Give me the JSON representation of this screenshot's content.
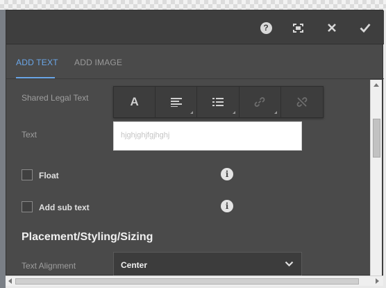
{
  "header": {
    "help_icon": "question-circle-icon",
    "fullscreen_icon": "fullscreen-icon",
    "close_icon": "close-icon",
    "confirm_icon": "checkmark-icon"
  },
  "tabs": [
    {
      "label": "ADD TEXT",
      "active": true
    },
    {
      "label": "ADD IMAGE",
      "active": false
    }
  ],
  "fields": {
    "shared_legal_text_label": "Shared Legal Text",
    "text_label": "Text",
    "text_value": "hjghjghjfgjhghj",
    "float_label": "Float",
    "add_sub_text_label": "Add sub text",
    "section_title": "Placement/Styling/Sizing",
    "text_alignment_label": "Text Alignment",
    "text_alignment_value": "Center"
  },
  "toolbar": {
    "buttons": [
      "format-text-icon",
      "align-left-icon",
      "bulleted-list-icon",
      "link-icon",
      "unlink-icon"
    ],
    "format_label": "A"
  },
  "info_glyph": "i",
  "colors": {
    "accent": "#6aa6e8",
    "panel_bg": "#4a4a4a",
    "header_bg": "#3e3e3e"
  }
}
